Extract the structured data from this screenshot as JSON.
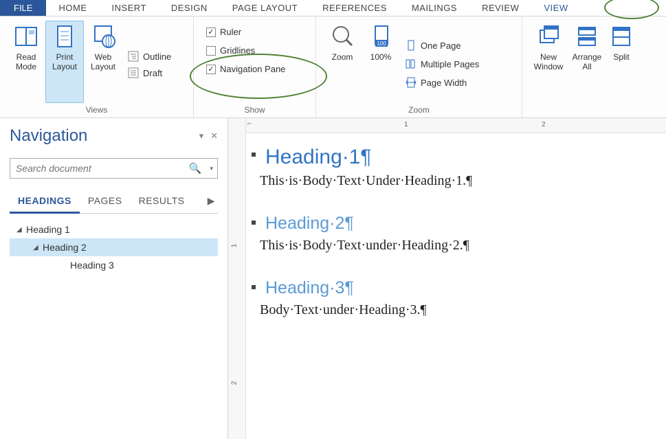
{
  "tabs": {
    "file": "FILE",
    "items": [
      "HOME",
      "INSERT",
      "DESIGN",
      "PAGE LAYOUT",
      "REFERENCES",
      "MAILINGS",
      "REVIEW",
      "VIEW"
    ],
    "active": "VIEW"
  },
  "ribbon": {
    "views": {
      "label": "Views",
      "read_mode": "Read Mode",
      "print_layout": "Print Layout",
      "web_layout": "Web Layout",
      "outline": "Outline",
      "draft": "Draft"
    },
    "show": {
      "label": "Show",
      "ruler": "Ruler",
      "gridlines": "Gridlines",
      "navpane": "Navigation Pane",
      "ruler_checked": true,
      "gridlines_checked": false,
      "navpane_checked": true
    },
    "zoom": {
      "label": "Zoom",
      "zoom": "Zoom",
      "hundred": "100%",
      "one_page": "One Page",
      "multiple_pages": "Multiple Pages",
      "page_width": "Page Width"
    },
    "window": {
      "new_window": "New Window",
      "arrange_all": "Arrange All",
      "split": "Split"
    }
  },
  "navpane": {
    "title": "Navigation",
    "search_placeholder": "Search document",
    "tabs": {
      "headings": "HEADINGS",
      "pages": "PAGES",
      "results": "RESULTS"
    },
    "tree": {
      "h1": "Heading 1",
      "h2": "Heading 2",
      "h3": "Heading 3"
    }
  },
  "ruler": {
    "marks": [
      "1",
      "2"
    ],
    "vmarks": [
      "1",
      "2"
    ]
  },
  "document": {
    "h1": "Heading·1¶",
    "p1": "This·is·Body·Text·Under·Heading·1.¶",
    "h2": "Heading·2¶",
    "p2": "This·is·Body·Text·under·Heading·2.¶",
    "h3": "Heading·3¶",
    "p3": "Body·Text·under·Heading·3.¶"
  }
}
